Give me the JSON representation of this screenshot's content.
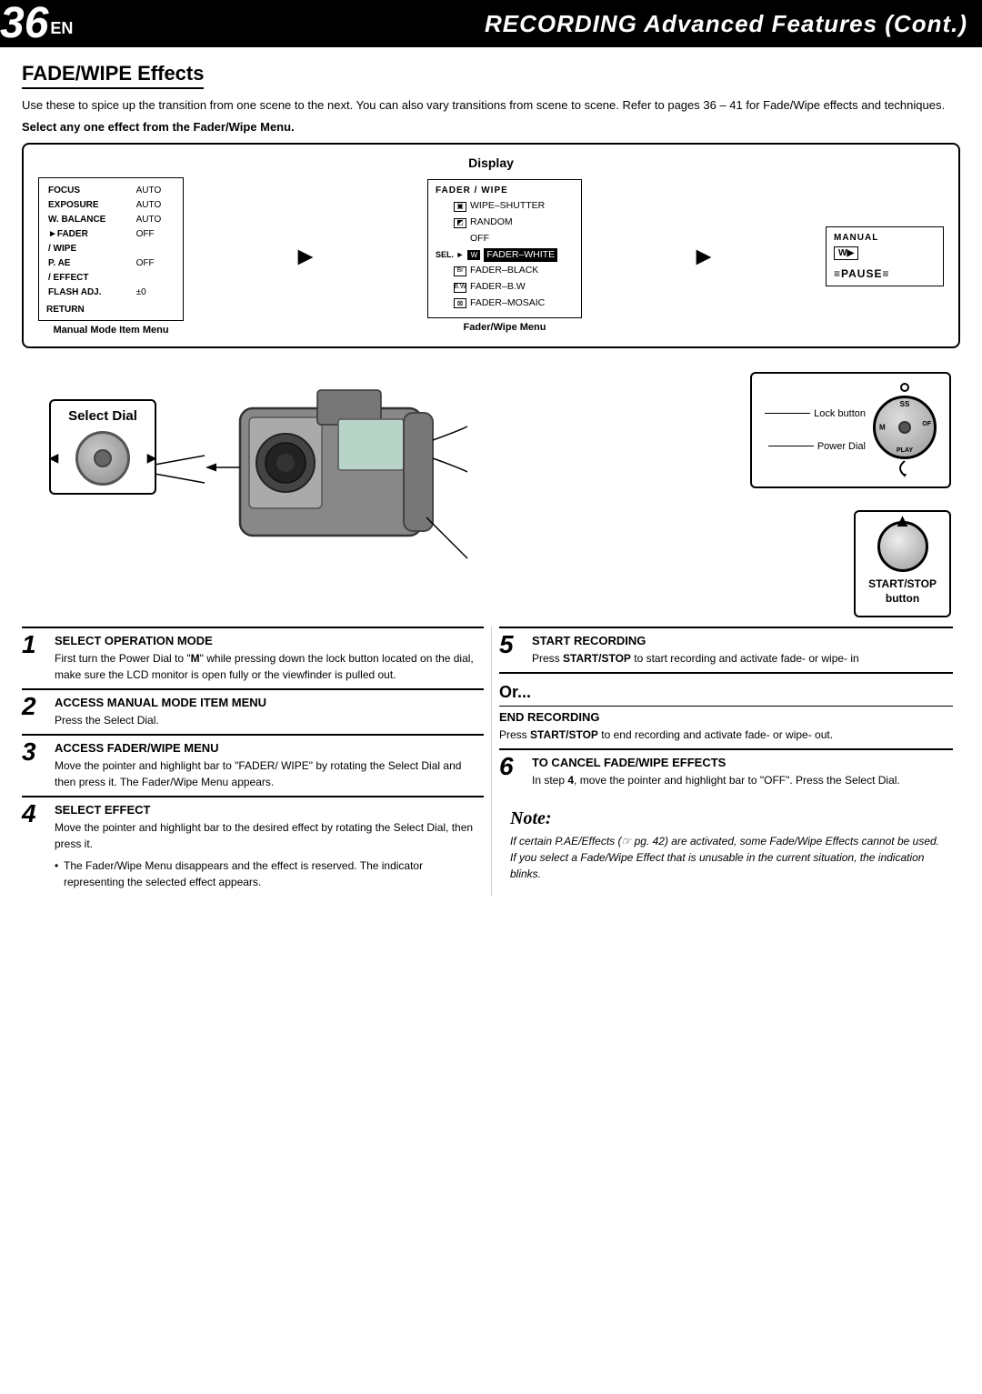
{
  "header": {
    "page_num": "36",
    "lang": "EN",
    "title": "RECORDING Advanced Features (Cont.)"
  },
  "section": {
    "title": "FADE/WIPE Effects",
    "intro": "Use these to spice up the transition from one scene to the next. You can also vary transitions from scene to scene. Refer to pages 36 – 41 for Fade/Wipe effects and techniques.",
    "select_instruction": "Select any one effect from the Fader/Wipe Menu.",
    "display_label": "Display"
  },
  "manual_menu": {
    "title": "Manual Mode Item Menu",
    "items": [
      {
        "label": "FOCUS",
        "value": "AUTO"
      },
      {
        "label": "EXPOSURE",
        "value": "AUTO"
      },
      {
        "label": "W. BALANCE",
        "value": "AUTO"
      },
      {
        "label": "►FADER",
        "value": "OFF"
      },
      {
        "label": "/ WIPE",
        "value": ""
      },
      {
        "label": "P. AE",
        "value": "OFF"
      },
      {
        "label": "/ EFFECT",
        "value": ""
      },
      {
        "label": "FLASH ADJ.",
        "value": "±0"
      }
    ],
    "return": "RETURN"
  },
  "fader_menu": {
    "title": "Fader/Wipe Menu",
    "items": [
      {
        "icon": "P",
        "label": "WIPE–SHUTTER"
      },
      {
        "icon": "R",
        "label": "RANDOM"
      },
      {
        "label": "OFF"
      },
      {
        "icon": "W",
        "label": "FADER–WHITE",
        "highlight": true
      },
      {
        "icon": "Br",
        "label": "FADER–BLACK"
      },
      {
        "icon": "BW",
        "label": "FADER–B.W"
      },
      {
        "icon": "X",
        "label": "FADER–MOSAIC"
      }
    ],
    "sel_label": "SEL. ►"
  },
  "manual_box": {
    "title": "MANUAL",
    "wu_label": "W▶",
    "pause": "≡PAUSE≡"
  },
  "select_dial": {
    "label": "Select Dial"
  },
  "labels": {
    "lock_button": "Lock button",
    "power_dial": "Power Dial",
    "start_stop": "START/STOP\nbutton"
  },
  "steps": [
    {
      "num": "1",
      "title": "SELECT OPERATION MODE",
      "body": "First turn the Power Dial to \"M\" while pressing down the lock button located on the dial, make sure the LCD monitor is open fully or the viewfinder is pulled out."
    },
    {
      "num": "2",
      "title": "ACCESS MANUAL MODE ITEM MENU",
      "body": "Press the Select Dial."
    },
    {
      "num": "3",
      "title": "ACCESS FADER/WIPE MENU",
      "body": "Move the pointer and highlight bar to \"FADER/ WIPE\" by rotating the Select Dial and then press it. The Fader/Wipe Menu appears."
    },
    {
      "num": "4",
      "title": "SELECT EFFECT",
      "body": "Move the pointer and highlight bar to the desired effect by rotating the Select Dial, then press it.",
      "bullet": "The Fader/Wipe Menu disappears and the effect is reserved. The indicator representing the selected effect appears."
    }
  ],
  "right_steps": [
    {
      "num": "5",
      "title": "START RECORDING",
      "body": "Press START/STOP to start recording and activate fade- or wipe- in"
    },
    {
      "or": "Or...",
      "end_title": "END RECORDING",
      "end_body": "Press START/STOP to end recording and activate fade- or wipe- out."
    },
    {
      "num": "6",
      "title": "TO CANCEL FADE/WIPE EFFECTS",
      "body": "In step 4, move the pointer and highlight bar to \"OFF\". Press the Select Dial."
    }
  ],
  "note": {
    "title": "Note:",
    "text": "If certain P.AE/Effects (☞ pg. 42) are activated, some Fade/Wipe Effects cannot be used. If you select a Fade/Wipe Effect that is unusable in the current situation, the indication blinks."
  }
}
